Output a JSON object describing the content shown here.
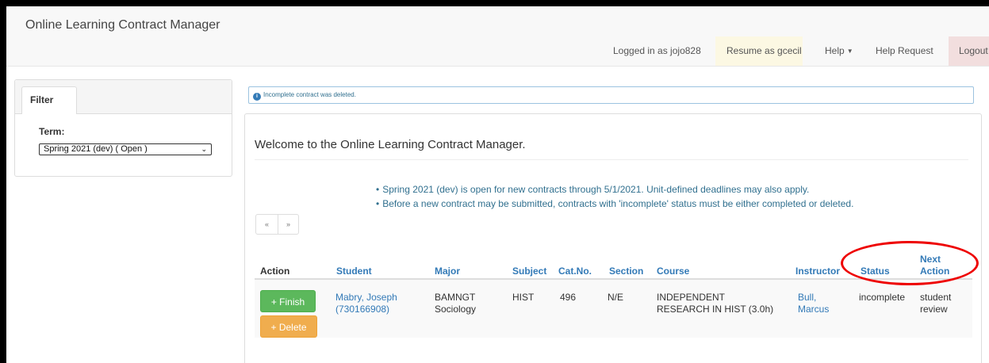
{
  "navbar": {
    "app_title": "Online Learning Contract Manager",
    "logged_in": "Logged in as jojo828",
    "resume": "Resume as gcecil",
    "help": "Help",
    "help_request": "Help Request",
    "logout": "Logout"
  },
  "filter": {
    "tab": "Filter",
    "term_label": "Term:",
    "term_value": "Spring 2021 (dev) ( Open )"
  },
  "alert": {
    "message": "Incomplete contract was deleted."
  },
  "main": {
    "welcome": "Welcome to the Online Learning Contract Manager.",
    "notices": [
      "Spring 2021 (dev) is open for new contracts through 5/1/2021. Unit-defined deadlines may also apply.",
      "Before a new contract may be submitted, contracts with 'incomplete' status must be either completed or deleted."
    ],
    "pager": {
      "prev": "«",
      "next": "»"
    }
  },
  "table": {
    "headers": {
      "action": "Action",
      "student": "Student",
      "major": "Major",
      "subject": "Subject",
      "catno": "Cat.No.",
      "section": "Section",
      "course": "Course",
      "instructor": "Instructor",
      "status": "Status",
      "next_action_1": "Next",
      "next_action_2": "Action"
    },
    "rows": [
      {
        "finish": "+ Finish",
        "delete": "+ Delete",
        "student_name": "Mabry, Joseph",
        "student_id": "(730166908)",
        "major_1": "BAMNGT",
        "major_2": "Sociology",
        "subject": "HIST",
        "catno": "496",
        "section": "N/E",
        "course_1": "INDEPENDENT",
        "course_2": "RESEARCH IN HIST (3.0h)",
        "instructor_1": "Bull,",
        "instructor_2": "Marcus",
        "status": "incomplete",
        "next_1": "student",
        "next_2": "review"
      }
    ]
  },
  "colors": {
    "success": "#5cb85c",
    "warning": "#f0ad4e",
    "link": "#337ab7",
    "annotation": "#ee0000"
  }
}
